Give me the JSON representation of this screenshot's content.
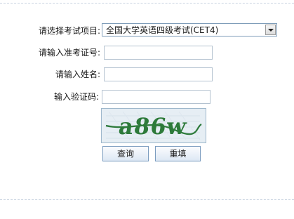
{
  "form": {
    "exam_label": "请选择考试项目:",
    "exam_selected": "全国大学英语四级考试(CET4)",
    "ticket_label": "请输入准考证号:",
    "ticket_value": "",
    "name_label": "请输入姓名:",
    "name_value": "",
    "code_label": "输入验证码:",
    "code_value": "",
    "captcha_text": "a86w",
    "query_label": "查询",
    "reset_label": "重填"
  },
  "colors": {
    "captcha_bg": "#e6eef4",
    "captcha_text": "#2d7a3a",
    "button_border": "#7b9cbf"
  },
  "icons": {
    "select_arrow": "chevron-down-icon"
  }
}
